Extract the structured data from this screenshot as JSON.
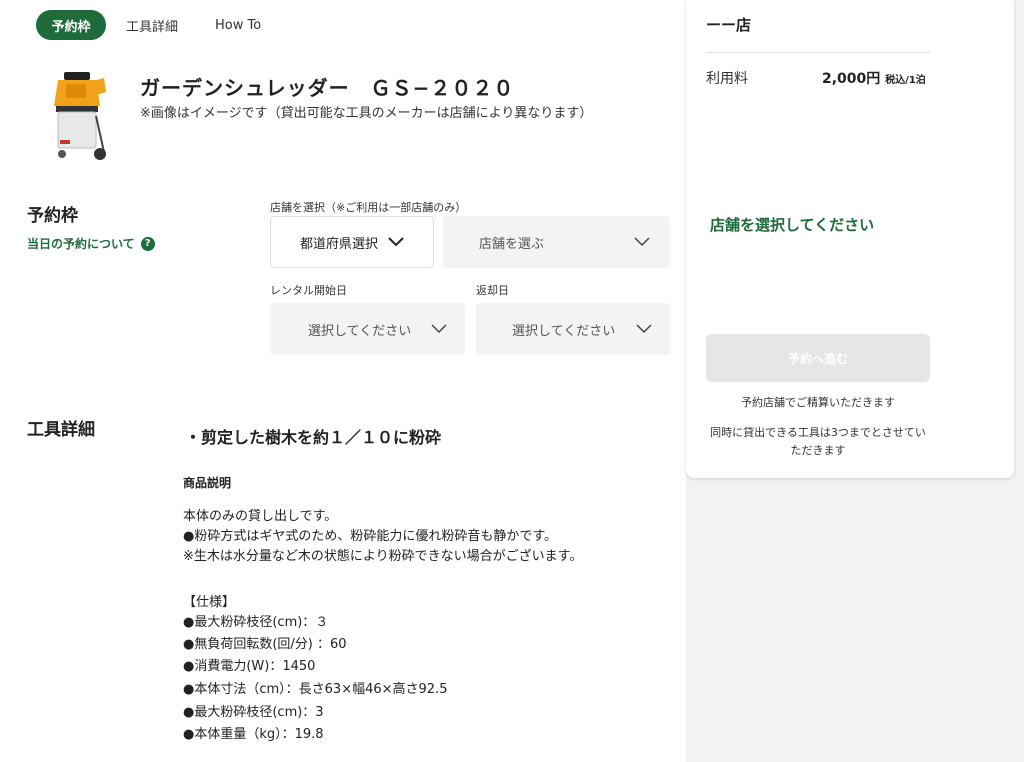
{
  "tabs": [
    {
      "label": "予約枠",
      "active": true
    },
    {
      "label": "工具詳細",
      "active": false
    },
    {
      "label": "How To",
      "active": false
    }
  ],
  "product": {
    "image_icon": "garden-shredder-image",
    "title": "ガーデンシュレッダー　ＧＳ−２０２０",
    "note": "※画像はイメージです（貸出可能な工具のメーカーは店舗により異なります）"
  },
  "reservation": {
    "heading": "予約枠",
    "same_day_link": "当日の予約について",
    "help_icon": "question-circle-icon",
    "store_label": "店舗を選択（※ご利用は一部店舗のみ）",
    "prefecture_select": "都道府県選択",
    "store_select": "店舗を選ぶ",
    "start_label": "レンタル開始日",
    "return_label": "返却日",
    "start_select": "選択してください",
    "return_select": "選択してください"
  },
  "details": {
    "heading": "工具詳細",
    "headline": "・剪定した樹木を約１／１０に粉砕",
    "desc_heading": "商品説明",
    "lines": [
      "本体のみの貸し出しです。",
      "●粉砕方式はギヤ式のため、粉砕能力に優れ粉砕音も静かです。",
      "※生木は水分量など木の状態により粉砕できない場合がございます。",
      "",
      "【仕様】",
      "●最大粉砕枝径(cm)：３",
      "●無負荷回転数(回/分) ：60",
      "●消費電力(W)：1450",
      "●本体寸法（cm）：長さ63×幅46×高さ92.5",
      "●最大粉砕枝径(cm)：3",
      "●本体重量（kg）：19.8"
    ]
  },
  "sidebar": {
    "store_name": "ーー店",
    "fee_label": "利用料",
    "fee_value": "2,000円",
    "fee_unit": "税込/1泊",
    "select_store_msg": "店舗を選択してください",
    "reserve_button": "予約へ進む",
    "note1": "予約店舗でご精算いただきます",
    "note2": "同時に貸出できる工具は3つまでとさせていただきます"
  },
  "colors": {
    "accent": "#1e6b3c",
    "button_disabled": "#e6e6e6",
    "panel_bg": "#f2f2f2"
  }
}
